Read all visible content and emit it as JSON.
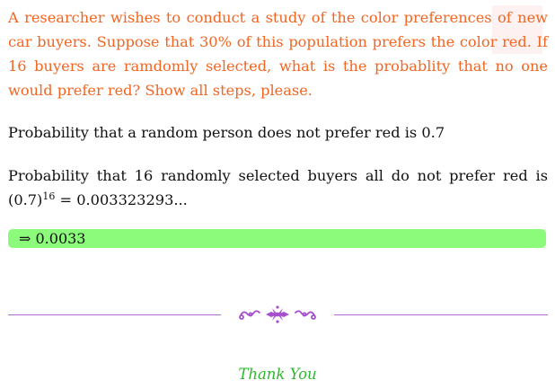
{
  "question": {
    "text": "A researcher wishes to conduct a study of the color preferences of new car buyers. Suppose that 30% of this population prefers the color red. If 16 buyers are ramdomly selected, what is the probablity that no one would prefer red? Show all steps, please."
  },
  "solution": {
    "step1": "Probability that a random person does not prefer red is 0.7",
    "step2_prefix": "Probability that 16 randomly selected buyers all do not prefer red is",
    "step2_base": "(0.7)",
    "step2_exponent": "16",
    "step2_result": " = 0.003323293...",
    "answer": "⇒ 0.0033"
  },
  "footer": {
    "thanks": "Thank You"
  },
  "colors": {
    "question": "#f26522",
    "answer_box": "#8cfb7c",
    "divider": "#b36bd4",
    "thanks": "#2eb82e"
  },
  "icons": {
    "watermark": "watermark-logo",
    "ornament": "floral-ornament-icon"
  }
}
